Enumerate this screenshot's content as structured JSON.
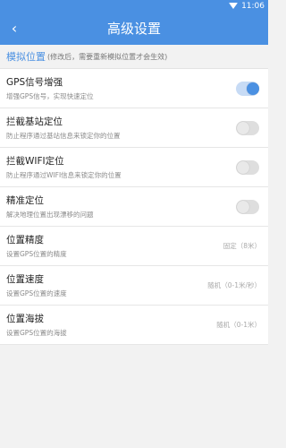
{
  "status_bar": {
    "time": "11:06"
  },
  "header": {
    "title": "高级设置",
    "back_icon": "back-arrow-icon"
  },
  "section": {
    "title": "模拟位置",
    "note": "(修改后，需要重新模拟位置才会生效)"
  },
  "rows": [
    {
      "title": "GPS信号增强",
      "subtitle": "增强GPS信号，实现快速定位",
      "type": "toggle",
      "on": true
    },
    {
      "title": "拦截基站定位",
      "subtitle": "防止程序通过基站信息来锁定你的位置",
      "type": "toggle",
      "on": false
    },
    {
      "title": "拦截WIFI定位",
      "subtitle": "防止程序通过WIFI信息来锁定你的位置",
      "type": "toggle",
      "on": false
    },
    {
      "title": "精准定位",
      "subtitle": "解决地理位置出现漂移的问题",
      "type": "toggle",
      "on": false
    },
    {
      "title": "位置精度",
      "subtitle": "设置GPS位置的精度",
      "type": "value",
      "value": "固定（8米）"
    },
    {
      "title": "位置速度",
      "subtitle": "设置GPS位置的速度",
      "type": "value",
      "value": "随机（0-1米/秒）"
    },
    {
      "title": "位置海拔",
      "subtitle": "设置GPS位置的海拔",
      "type": "value",
      "value": "随机（0-1米）"
    }
  ],
  "colors": {
    "accent": "#4a90e2"
  }
}
